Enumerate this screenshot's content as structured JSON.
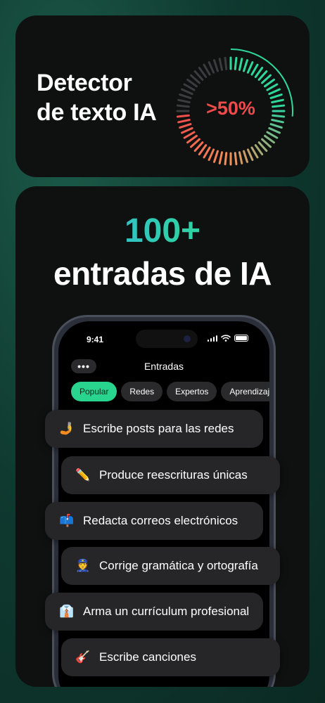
{
  "detector": {
    "title": "Detector\nde texto IA",
    "gauge_value": ">50%",
    "gauge_fraction": 0.5,
    "colors": {
      "green": "#2fd89a",
      "red": "#f04a4a",
      "orange": "#f2905a",
      "gray": "#3a3c3e"
    }
  },
  "headline": {
    "number": "100+",
    "text": "entradas de IA"
  },
  "phone": {
    "time": "9:41",
    "menu_label": "•••",
    "title": "Entradas",
    "tabs": [
      {
        "label": "Popular",
        "active": true
      },
      {
        "label": "Redes",
        "active": false
      },
      {
        "label": "Expertos",
        "active": false
      },
      {
        "label": "Aprendizaje",
        "active": false
      }
    ]
  },
  "prompts": [
    {
      "icon": "selfie-icon",
      "emoji": "🤳",
      "label": "Escribe posts para las redes"
    },
    {
      "icon": "pencil-icon",
      "emoji": "✏️",
      "label": "Produce reescrituras únicas"
    },
    {
      "icon": "mailbox-icon",
      "emoji": "📫",
      "label": "Redacta correos electrónicos"
    },
    {
      "icon": "police-officer-icon",
      "emoji": "👮",
      "label": "Corrige gramática y ortografía"
    },
    {
      "icon": "shirt-icon",
      "emoji": "👔",
      "label": "Arma un currículum profesional"
    },
    {
      "icon": "guitar-icon",
      "emoji": "🎸",
      "label": "Escribe canciones"
    }
  ],
  "brand_gradient": [
    "#35a6ff",
    "#2fd0a8",
    "#30e08a"
  ]
}
